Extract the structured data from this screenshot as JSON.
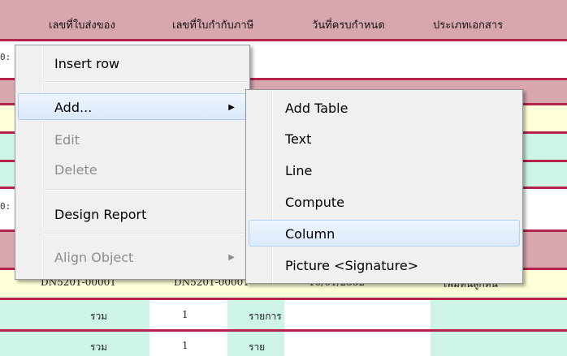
{
  "report": {
    "headers": [
      "เลขที่ใบส่งของ",
      "เลขที่ใบกำกับภาษี",
      "วันที่ครบกำหนด",
      "ประเภทเอกสาร"
    ],
    "detail_row": {
      "delivery_no": "DN5201-00001",
      "tax_invoice_no": "DN5201-00001",
      "due_date": "10/01/2552",
      "doc_type": "เพิ่มหนี้ลูกหนี้"
    },
    "summary_rows": [
      {
        "label": "รวม",
        "count": "1",
        "unit": "รายการ"
      },
      {
        "label": "รวม",
        "count": "1",
        "unit": "ราย"
      }
    ]
  },
  "context_menu": {
    "items": [
      {
        "label": "Insert row",
        "enabled": true
      },
      {
        "label": "Add...",
        "enabled": true,
        "submenu": true
      },
      {
        "label": "Edit",
        "enabled": false
      },
      {
        "label": "Delete",
        "enabled": false
      },
      {
        "label": "Design Report",
        "enabled": true
      },
      {
        "label": "Align Object",
        "enabled": false,
        "submenu": true
      }
    ],
    "submenu_arrow": "▶"
  },
  "add_submenu": {
    "items": [
      {
        "label": "Add Table"
      },
      {
        "label": "Text"
      },
      {
        "label": "Line"
      },
      {
        "label": "Compute"
      },
      {
        "label": "Column",
        "highlighted": true
      },
      {
        "label": "Picture <Signature>"
      }
    ]
  },
  "colors": {
    "band_pink": "#d8a6ae",
    "band_green": "#cdf4e4",
    "band_yellow": "#ffffd9",
    "divider": "#b4234b",
    "menu_bg": "#f0f0f0",
    "menu_hover": "#d9e9fb"
  }
}
